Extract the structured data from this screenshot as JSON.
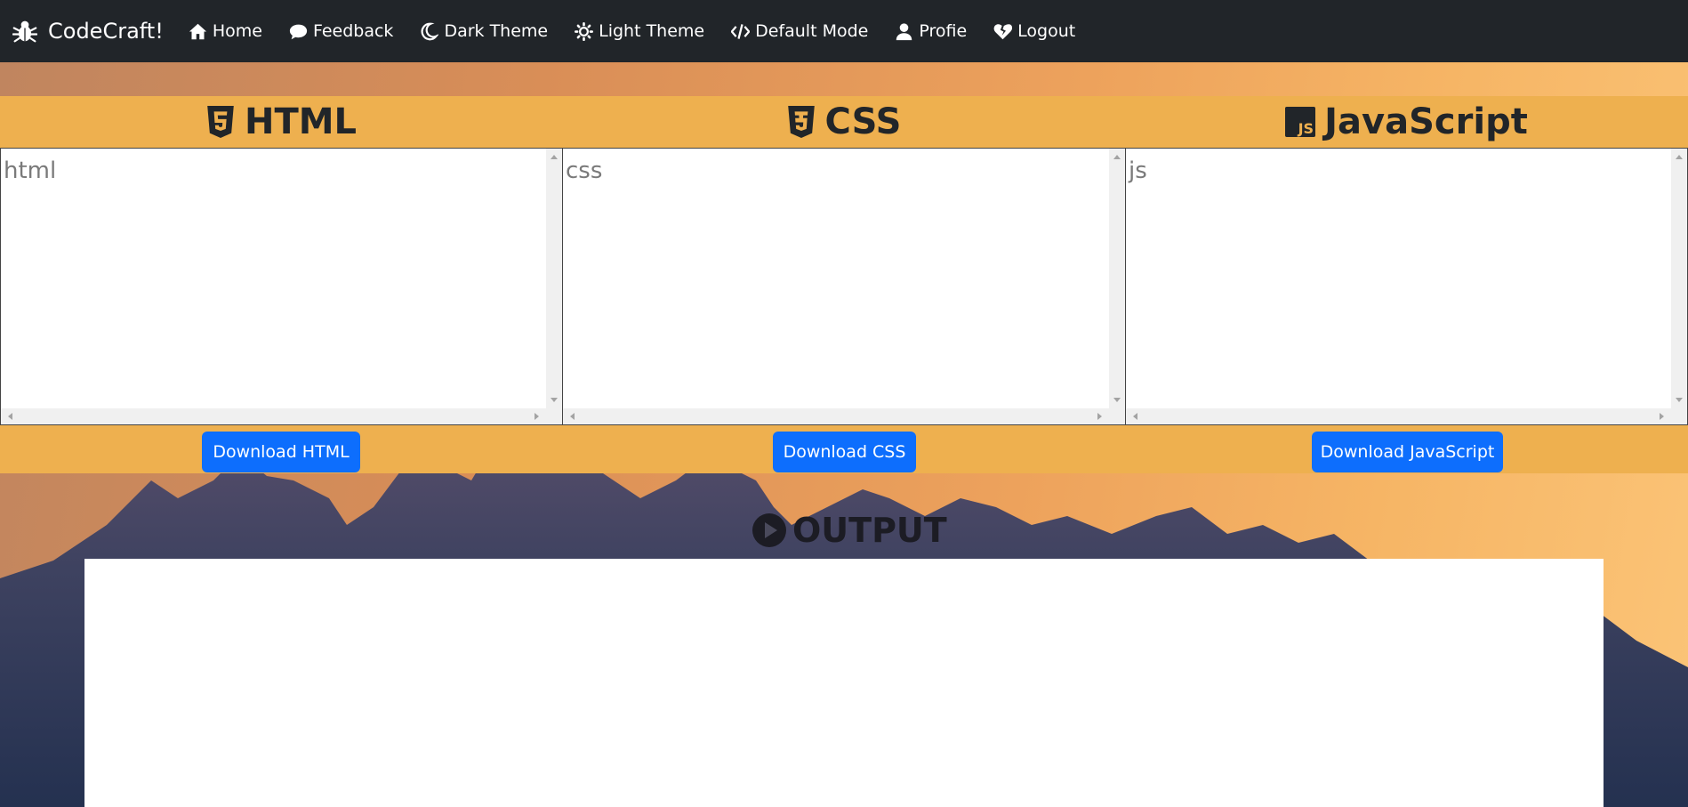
{
  "navbar": {
    "brand": "CodeCraft!",
    "brand_icon": "bug-icon",
    "items": [
      {
        "label": "Home",
        "icon": "home-icon"
      },
      {
        "label": "Feedback",
        "icon": "comment-icon"
      },
      {
        "label": "Dark Theme",
        "icon": "moon-icon"
      },
      {
        "label": "Light Theme",
        "icon": "sun-icon"
      },
      {
        "label": "Default Mode",
        "icon": "code-icon"
      },
      {
        "label": "Profie",
        "icon": "user-icon"
      },
      {
        "label": "Logout",
        "icon": "heart-crack-icon"
      }
    ]
  },
  "editors": [
    {
      "title": "HTML",
      "icon": "html5-icon",
      "placeholder": "html",
      "value": "",
      "download_label": "Download HTML"
    },
    {
      "title": "CSS",
      "icon": "css3-icon",
      "placeholder": "css",
      "value": "",
      "download_label": "Download CSS"
    },
    {
      "title": "JavaScript",
      "icon": "js-icon",
      "placeholder": "js",
      "value": "",
      "download_label": "Download JavaScript"
    }
  ],
  "output": {
    "title": "OUTPUT",
    "icon": "play-circle-icon"
  },
  "colors": {
    "navbar_bg": "#212529",
    "band_bg": "#eeb04f",
    "button_bg": "#0d6efd",
    "text_dark": "#212529"
  }
}
